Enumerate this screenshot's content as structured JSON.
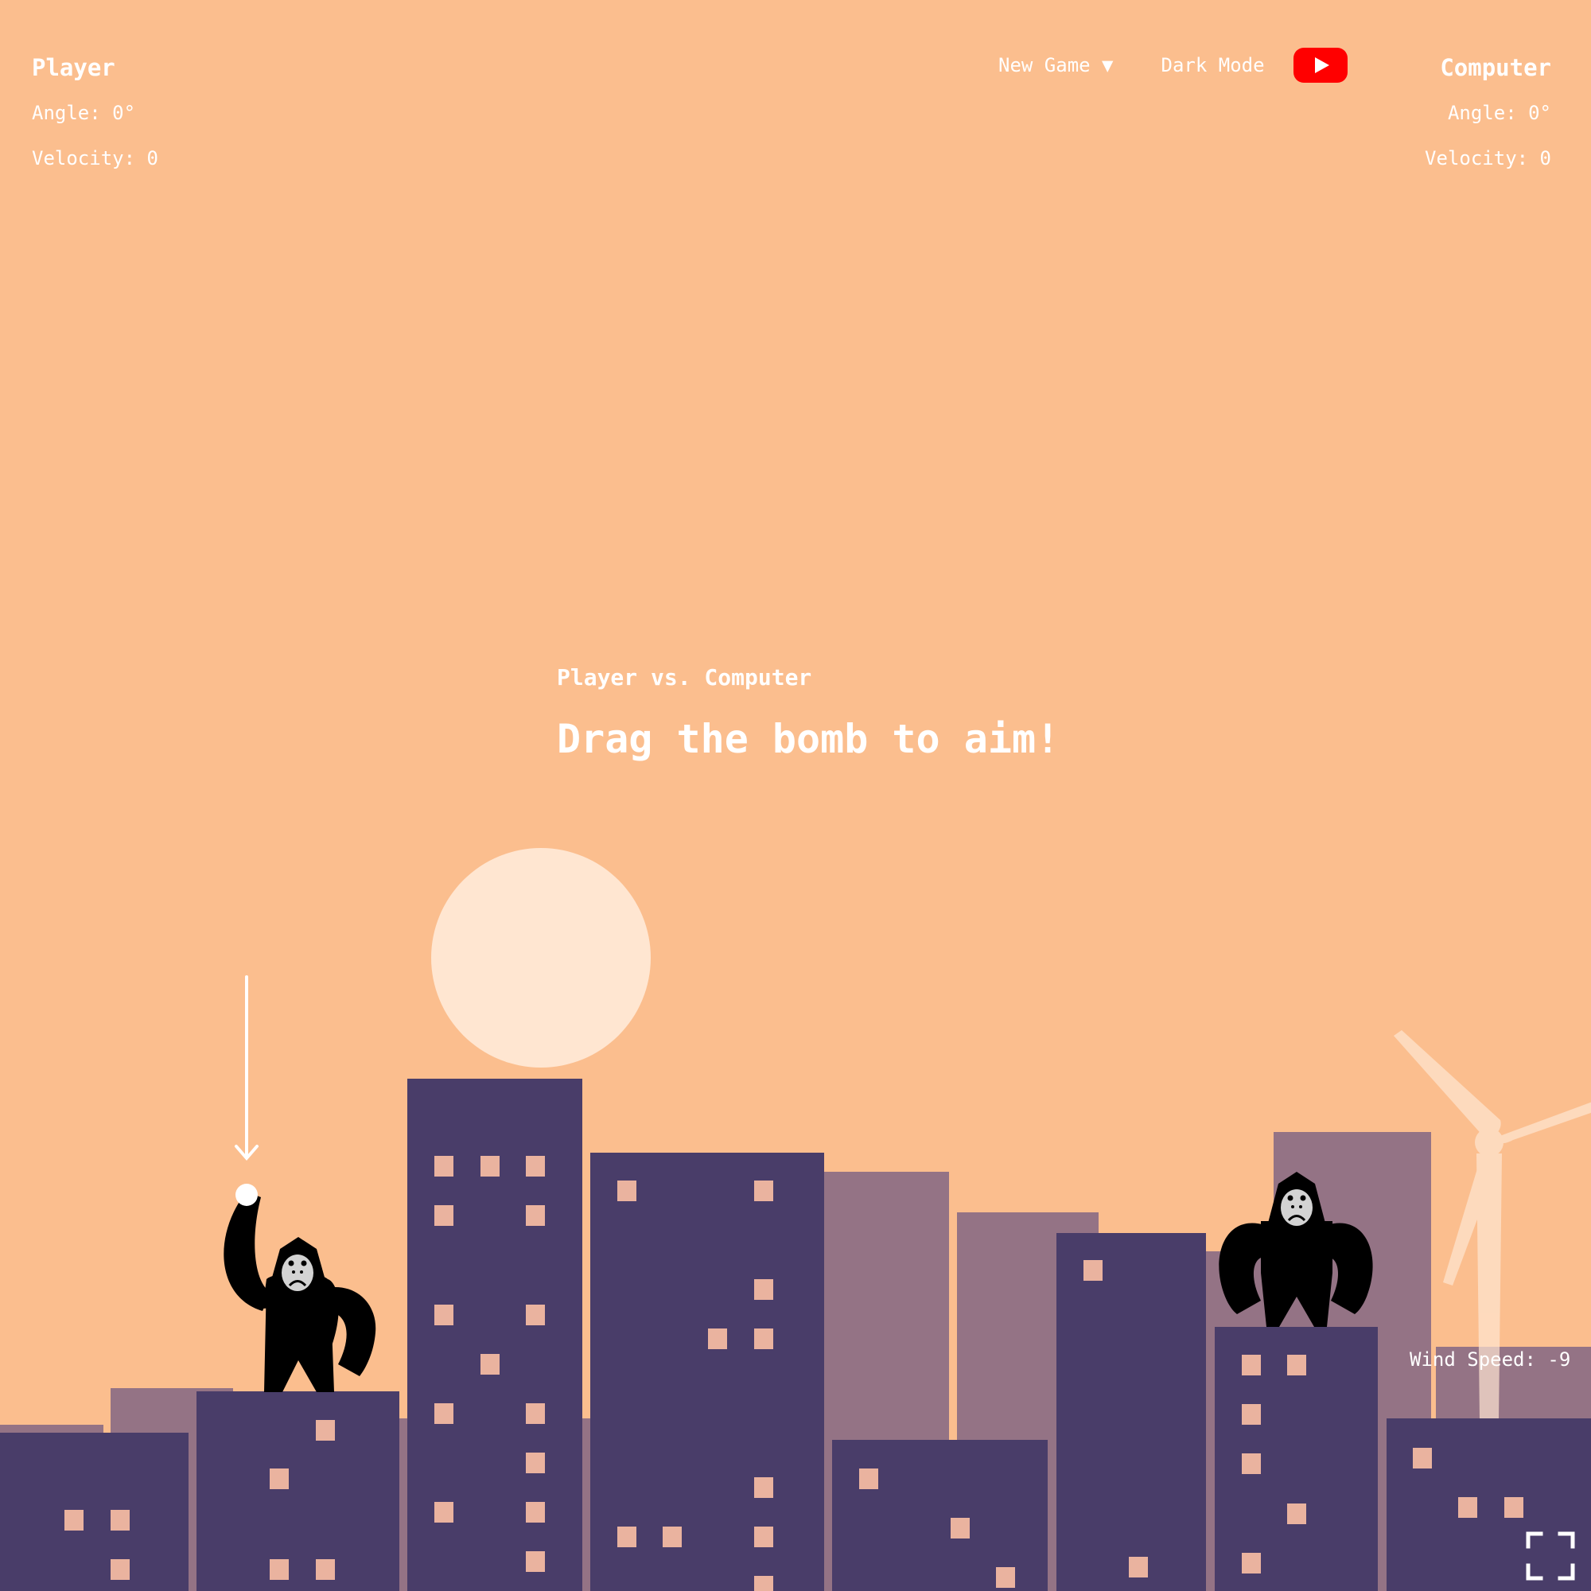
{
  "player1": {
    "name": "Player",
    "angle_label": "Angle: 0°",
    "velocity_label": "Velocity: 0"
  },
  "player2": {
    "name": "Computer",
    "angle_label": "Angle: 0°",
    "velocity_label": "Velocity: 0"
  },
  "nav": {
    "new_game_label": "New Game ▼",
    "dark_mode_label": "Dark Mode",
    "video_icon": "youtube-play-icon"
  },
  "instructions": {
    "subtitle": "Player vs. Computer",
    "title": "Drag the bomb to aim!"
  },
  "wind": {
    "label": "Wind Speed: -9",
    "value": -9
  },
  "fullscreen_icon": "fullscreen-icon",
  "colors": {
    "sky": "#FBBE8E",
    "sun": "#FFE6D1",
    "back_buildings": "#947385",
    "front_buildings": "#493D69",
    "windows": "#EAB39F",
    "gorilla": "#000000",
    "gorilla_face": "#d3d3d3",
    "youtube_red": "#FF0000"
  }
}
